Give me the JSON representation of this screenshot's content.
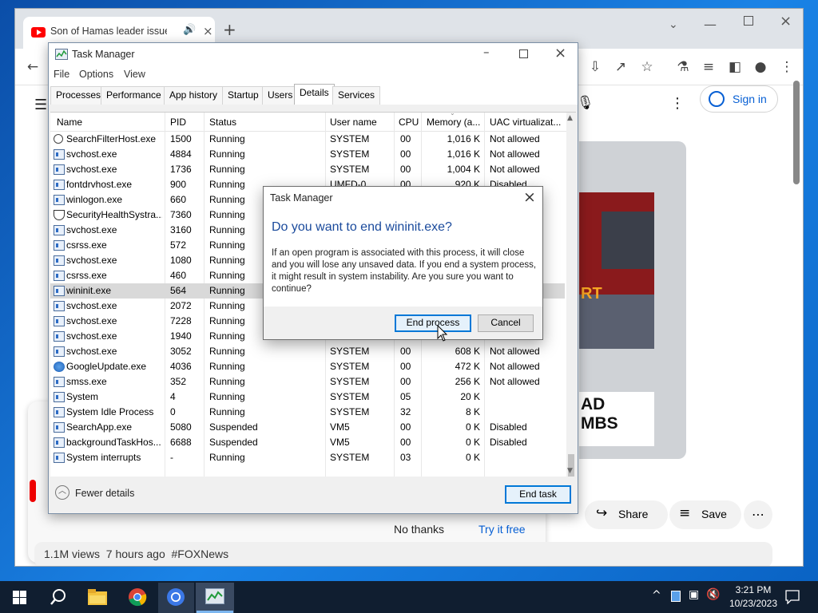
{
  "chrome": {
    "tab_title": "Son of Hamas leader issues",
    "sign_in": "Sign in",
    "share": "Share",
    "save": "Save",
    "no_thanks": "No thanks",
    "try_free": "Try it free",
    "video_meta": "1.1M views  7 hours ago  #FOXNews",
    "thumb_text_1": "AD",
    "thumb_text_2": "MBS",
    "thumb_text_3": "RT"
  },
  "task_manager": {
    "title": "Task Manager",
    "menu": [
      "File",
      "Options",
      "View"
    ],
    "tabs": [
      "Processes",
      "Performance",
      "App history",
      "Startup",
      "Users",
      "Details",
      "Services"
    ],
    "active_tab": "Details",
    "columns": [
      "Name",
      "PID",
      "Status",
      "User name",
      "CPU",
      "Memory (a...",
      "UAC virtualizat..."
    ],
    "rows": [
      {
        "name": "SearchFilterHost.exe",
        "pid": "1500",
        "status": "Running",
        "user": "SYSTEM",
        "cpu": "00",
        "mem": "1,016 K",
        "uac": "Not allowed",
        "icon": "search"
      },
      {
        "name": "svchost.exe",
        "pid": "4884",
        "status": "Running",
        "user": "SYSTEM",
        "cpu": "00",
        "mem": "1,016 K",
        "uac": "Not allowed",
        "icon": "app"
      },
      {
        "name": "svchost.exe",
        "pid": "1736",
        "status": "Running",
        "user": "SYSTEM",
        "cpu": "00",
        "mem": "1,004 K",
        "uac": "Not allowed",
        "icon": "app"
      },
      {
        "name": "fontdrvhost.exe",
        "pid": "900",
        "status": "Running",
        "user": "UMFD-0",
        "cpu": "00",
        "mem": "920 K",
        "uac": "Disabled",
        "icon": "app"
      },
      {
        "name": "winlogon.exe",
        "pid": "660",
        "status": "Running",
        "user": "",
        "cpu": "",
        "mem": "",
        "uac": "",
        "icon": "app"
      },
      {
        "name": "SecurityHealthSystra...",
        "pid": "7360",
        "status": "Running",
        "user": "",
        "cpu": "",
        "mem": "",
        "uac": "",
        "icon": "shield"
      },
      {
        "name": "svchost.exe",
        "pid": "3160",
        "status": "Running",
        "user": "",
        "cpu": "",
        "mem": "",
        "uac": "",
        "icon": "app"
      },
      {
        "name": "csrss.exe",
        "pid": "572",
        "status": "Running",
        "user": "",
        "cpu": "",
        "mem": "",
        "uac": "",
        "icon": "app"
      },
      {
        "name": "svchost.exe",
        "pid": "1080",
        "status": "Running",
        "user": "",
        "cpu": "",
        "mem": "",
        "uac": "",
        "icon": "app"
      },
      {
        "name": "csrss.exe",
        "pid": "460",
        "status": "Running",
        "user": "",
        "cpu": "",
        "mem": "",
        "uac": "",
        "icon": "app"
      },
      {
        "name": "wininit.exe",
        "pid": "564",
        "status": "Running",
        "user": "",
        "cpu": "",
        "mem": "",
        "uac": "",
        "icon": "app",
        "selected": true
      },
      {
        "name": "svchost.exe",
        "pid": "2072",
        "status": "Running",
        "user": "",
        "cpu": "",
        "mem": "",
        "uac": "",
        "icon": "app"
      },
      {
        "name": "svchost.exe",
        "pid": "7228",
        "status": "Running",
        "user": "",
        "cpu": "",
        "mem": "",
        "uac": "",
        "icon": "app"
      },
      {
        "name": "svchost.exe",
        "pid": "1940",
        "status": "Running",
        "user": "",
        "cpu": "",
        "mem": "",
        "uac": "",
        "icon": "app"
      },
      {
        "name": "svchost.exe",
        "pid": "3052",
        "status": "Running",
        "user": "SYSTEM",
        "cpu": "00",
        "mem": "608 K",
        "uac": "Not allowed",
        "icon": "app"
      },
      {
        "name": "GoogleUpdate.exe",
        "pid": "4036",
        "status": "Running",
        "user": "SYSTEM",
        "cpu": "00",
        "mem": "472 K",
        "uac": "Not allowed",
        "icon": "gu"
      },
      {
        "name": "smss.exe",
        "pid": "352",
        "status": "Running",
        "user": "SYSTEM",
        "cpu": "00",
        "mem": "256 K",
        "uac": "Not allowed",
        "icon": "app"
      },
      {
        "name": "System",
        "pid": "4",
        "status": "Running",
        "user": "SYSTEM",
        "cpu": "05",
        "mem": "20 K",
        "uac": "",
        "icon": "app"
      },
      {
        "name": "System Idle Process",
        "pid": "0",
        "status": "Running",
        "user": "SYSTEM",
        "cpu": "32",
        "mem": "8 K",
        "uac": "",
        "icon": "app"
      },
      {
        "name": "SearchApp.exe",
        "pid": "5080",
        "status": "Suspended",
        "user": "VM5",
        "cpu": "00",
        "mem": "0 K",
        "uac": "Disabled",
        "icon": "app"
      },
      {
        "name": "backgroundTaskHos...",
        "pid": "6688",
        "status": "Suspended",
        "user": "VM5",
        "cpu": "00",
        "mem": "0 K",
        "uac": "Disabled",
        "icon": "app"
      },
      {
        "name": "System interrupts",
        "pid": "-",
        "status": "Running",
        "user": "SYSTEM",
        "cpu": "03",
        "mem": "0 K",
        "uac": "",
        "icon": "app"
      }
    ],
    "fewer_details": "Fewer details",
    "end_task": "End task"
  },
  "dialog": {
    "title": "Task Manager",
    "heading": "Do you want to end wininit.exe?",
    "body": "If an open program is associated with this process, it will close and you will lose any unsaved data. If you end a system process, it might result in system instability. Are you sure you want to continue?",
    "end_process": "End process",
    "cancel": "Cancel"
  },
  "taskbar": {
    "time": "3:21 PM",
    "date": "10/23/2023"
  },
  "colors": {
    "dialog_heading": "#1a4a9c",
    "accent": "#0078d7",
    "taskbar": "#101e30"
  }
}
